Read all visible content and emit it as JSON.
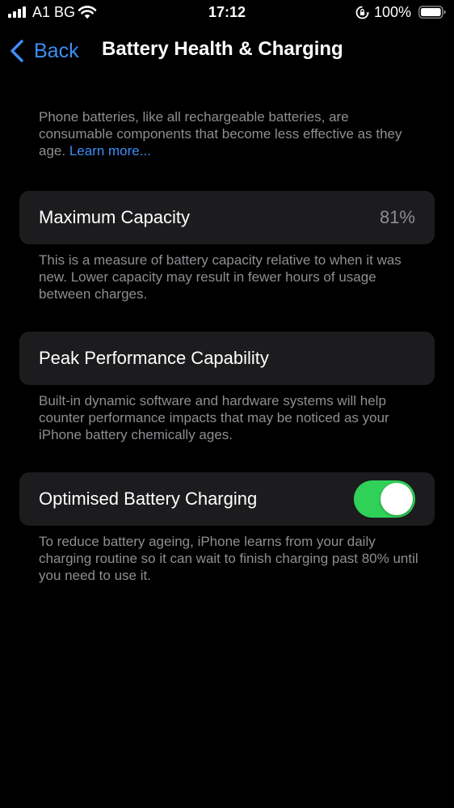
{
  "status_bar": {
    "carrier": "A1 BG",
    "time": "17:12",
    "battery_percent": "100%",
    "icons": [
      "signal-icon",
      "wifi-icon",
      "orientation-lock-icon",
      "battery-icon"
    ]
  },
  "nav": {
    "back_label": "Back",
    "title": "Battery Health & Charging"
  },
  "intro": {
    "text": "Phone batteries, like all rechargeable batteries, are consumable components that become less effective as they age. ",
    "link": "Learn more..."
  },
  "max_capacity": {
    "label": "Maximum Capacity",
    "value": "81%",
    "footer": "This is a measure of battery capacity relative to when it was new. Lower capacity may result in fewer hours of usage between charges."
  },
  "peak_performance": {
    "label": "Peak Performance Capability",
    "footer": "Built-in dynamic software and hardware systems will help counter performance impacts that may be noticed as your iPhone battery chemically ages."
  },
  "optimised_charging": {
    "label": "Optimised Battery Charging",
    "enabled": true,
    "footer": "To reduce battery ageing, iPhone learns from your daily charging routine so it can wait to finish charging past 80% until you need to use it."
  },
  "colors": {
    "background": "#000000",
    "cell": "#1c1c1e",
    "accent": "#3d8ef7",
    "secondary_text": "#8e8e93",
    "toggle_on": "#30d158"
  }
}
